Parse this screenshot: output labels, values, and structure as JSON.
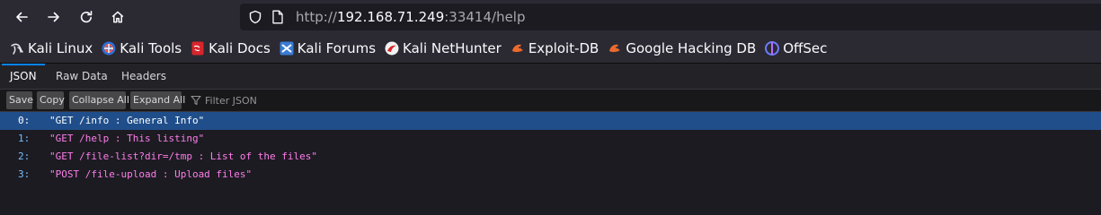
{
  "browser": {
    "url": {
      "scheme": "http://",
      "host": "192.168.71.249",
      "rest": ":33414/help"
    },
    "icons": [
      "back-arrow-icon",
      "forward-arrow-icon",
      "reload-icon",
      "home-icon",
      "shield-icon",
      "page-icon"
    ]
  },
  "bookmarks": [
    {
      "label": "Kali Linux",
      "icon": "kali-dragon-icon"
    },
    {
      "label": "Kali Tools",
      "icon": "kali-tools-icon"
    },
    {
      "label": "Kali Docs",
      "icon": "kali-docs-icon"
    },
    {
      "label": "Kali Forums",
      "icon": "kali-forums-icon"
    },
    {
      "label": "Kali NetHunter",
      "icon": "nethunter-icon"
    },
    {
      "label": "Exploit-DB",
      "icon": "exploit-db-icon"
    },
    {
      "label": "Google Hacking DB",
      "icon": "ghdb-icon"
    },
    {
      "label": "OffSec",
      "icon": "offsec-icon"
    }
  ],
  "viewer": {
    "tabs": [
      "JSON",
      "Raw Data",
      "Headers"
    ],
    "active_tab": "JSON",
    "toolbar": {
      "save": "Save",
      "copy": "Copy",
      "collapse_all": "Collapse All",
      "expand_all": "Expand All",
      "filter_placeholder": "Filter JSON"
    },
    "rows": [
      {
        "key": "0:",
        "value": "\"GET /info : General Info\""
      },
      {
        "key": "1:",
        "value": "\"GET /help : This listing\""
      },
      {
        "key": "2:",
        "value": "\"GET /file-list?dir=/tmp : List of the files\""
      },
      {
        "key": "3:",
        "value": "\"POST /file-upload : Upload files\""
      }
    ],
    "selected_row": 0
  },
  "colors": {
    "accent": "#0a84ff",
    "selected_row": "#204e8a",
    "string_value": "#ff7de9",
    "key": "#75bfff"
  }
}
